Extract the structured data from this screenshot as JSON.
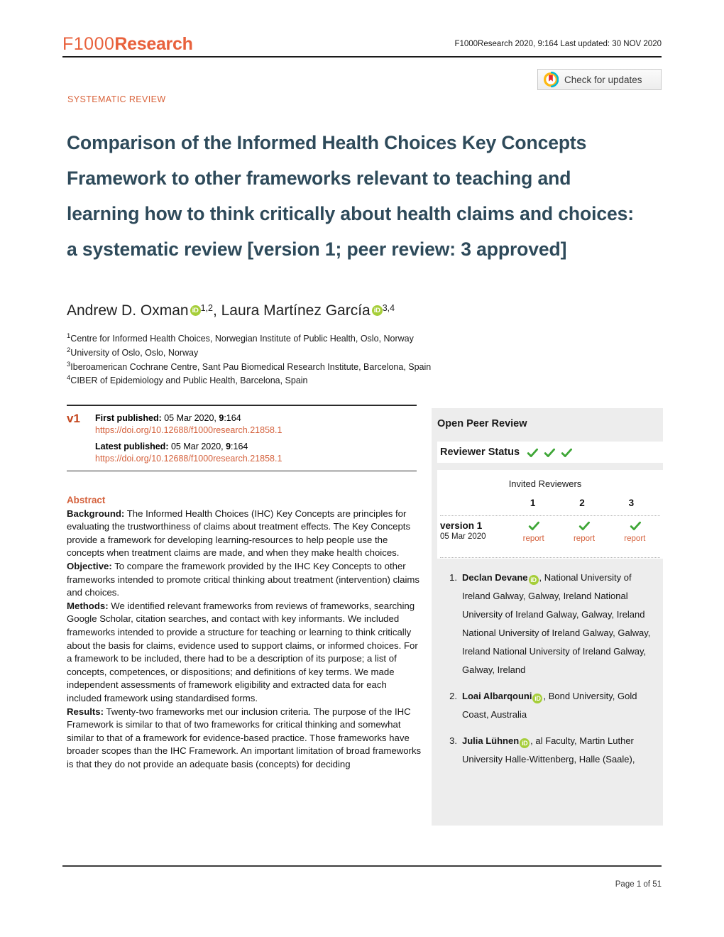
{
  "header": {
    "logo_f1000": "F1000",
    "logo_research": "Research",
    "citation": "F1000Research 2020, 9:164 Last updated: 30 NOV 2020"
  },
  "crossmark": {
    "label": "Check for updates",
    "icon": "crossmark-icon"
  },
  "article": {
    "type": "SYSTEMATIC REVIEW",
    "title": "Comparison of the Informed Health Choices Key Concepts Framework to other frameworks relevant to teaching and learning how to think critically about health claims and choices: a systematic review [version 1; peer review: 3 approved]"
  },
  "authors": {
    "author1_name": "Andrew D. Oxman",
    "author1_sup": "1,2",
    "separator": ", ",
    "author2_name": "Laura Martínez García",
    "author2_sup": "3,4",
    "orcid_label": "iD"
  },
  "affiliations": [
    {
      "sup": "1",
      "text": "Centre for Informed Health Choices, Norwegian Institute of Public Health, Oslo, Norway"
    },
    {
      "sup": "2",
      "text": "University of Oslo, Oslo, Norway"
    },
    {
      "sup": "3",
      "text": "Iberoamerican Cochrane Centre, Sant Pau Biomedical Research Institute, Barcelona, Spain"
    },
    {
      "sup": "4",
      "text": "CIBER of Epidemiology and Public Health, Barcelona, Spain"
    }
  ],
  "version_block": {
    "tag": "v1",
    "first_label": "First published:",
    "first_value": " 05 Mar 2020, ",
    "first_vol": "9",
    "first_issue": ":164",
    "first_doi": "https://doi.org/10.12688/f1000research.21858.1",
    "latest_label": "Latest published:",
    "latest_value": " 05 Mar 2020, ",
    "latest_vol": "9",
    "latest_issue": ":164",
    "latest_doi": "https://doi.org/10.12688/f1000research.21858.1"
  },
  "abstract": {
    "heading": "Abstract",
    "background_label": "Background:",
    "background_text": " The Informed Health Choices (IHC) Key Concepts are principles for evaluating the trustworthiness of claims about treatment effects. The Key Concepts provide a framework for developing learning-resources to help people use the concepts when treatment claims are made, and when they make health choices.",
    "objective_label": "Objective:",
    "objective_text": " To compare the framework provided by the IHC Key Concepts to other frameworks intended to promote critical thinking about treatment (intervention) claims and choices.",
    "methods_label": "Methods:",
    "methods_text": " We identified relevant frameworks from reviews of frameworks, searching Google Scholar, citation searches, and contact with key informants. We included frameworks intended to provide a structure for teaching or learning to think critically about the basis for claims, evidence used to support claims, or informed choices. For a framework to be included, there had to be a description of its purpose; a list of concepts, competences, or dispositions; and definitions of key terms. We made independent assessments of framework eligibility and extracted data for each included framework using standardised forms.",
    "results_label": "Results:",
    "results_text": " Twenty-two frameworks met our inclusion criteria. The purpose of the IHC Framework is similar to that of two frameworks for critical thinking and somewhat similar to that of a framework for evidence-based practice. Those frameworks have broader scopes than the IHC Framework. An important limitation of broad frameworks is that they do not provide an adequate basis (concepts) for deciding"
  },
  "open_peer_review": {
    "title": "Open Peer Review",
    "reviewer_status_label": "Reviewer Status",
    "status_ticks": 3,
    "invited_reviewers_label": "Invited Reviewers",
    "reviewer_numbers": [
      "1",
      "2",
      "3"
    ],
    "version_label": "version 1",
    "version_date": "05 Mar 2020",
    "report_label": "report",
    "report_cells": [
      {
        "tick": true,
        "label": "report"
      },
      {
        "tick": true,
        "label": "report"
      },
      {
        "tick": true,
        "label": "report"
      }
    ],
    "reviewers": [
      {
        "num": "1.",
        "name": "Declan Devane",
        "affiliation": ", National University of Ireland Galway, Galway, Ireland National University of Ireland Galway, Galway, Ireland National University of Ireland Galway, Galway, Ireland National University of Ireland Galway, Galway, Ireland"
      },
      {
        "num": "2.",
        "name": "Loai Albarqouni",
        "affiliation": ", Bond University, Gold Coast, Australia"
      },
      {
        "num": "3.",
        "name": "Julia Lühnen",
        "affiliation": ", al Faculty, Martin Luther University Halle-Wittenberg, Halle (Saale),"
      }
    ],
    "orcid_label": "iD"
  },
  "footer": {
    "page_label": "Page 1 of 51"
  },
  "colors": {
    "brand_orange": "#E8613C",
    "title_slate": "#2E4A5A",
    "link_orange": "#D4603B",
    "orcid_green": "#A6CE39",
    "tick_green": "#3EA636",
    "sidebar_gray": "#EDEDED"
  }
}
